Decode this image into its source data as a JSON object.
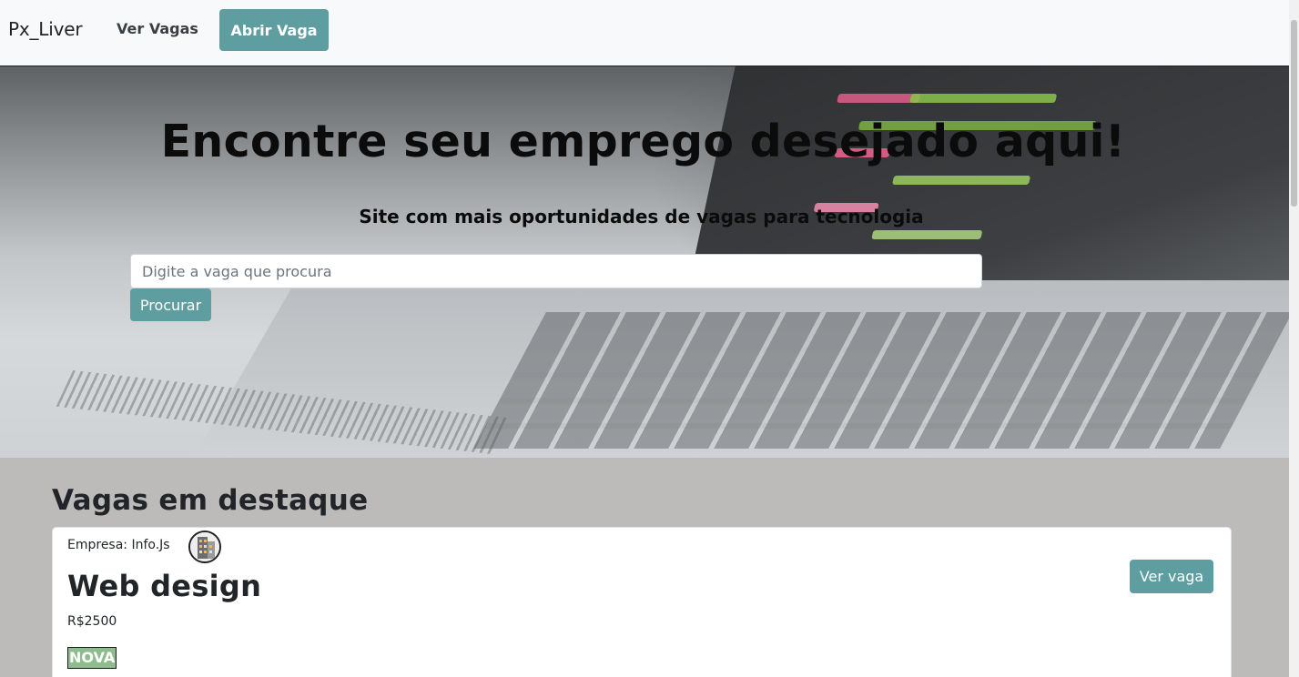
{
  "navbar": {
    "brand": "Px_Liver",
    "link_view_jobs": "Ver Vagas",
    "cta_open_job": "Abrir Vaga"
  },
  "hero": {
    "title": "Encontre seu emprego desejado aqui!",
    "subtitle": "Site com mais oportunidades de vagas para tecnologia",
    "search": {
      "placeholder": "Digite a vaga que procura",
      "value": "",
      "button_label": "Procurar"
    }
  },
  "featured": {
    "title": "Vagas em destaque",
    "jobs": [
      {
        "company": "Empresa: Info.Js",
        "company_icon": "building-icon",
        "title": "Web design",
        "salary": "R$2500",
        "badge": "NOVA",
        "button_label": "Ver vaga"
      }
    ]
  },
  "colors": {
    "accent": "#5f9ea0",
    "badge_new": "#8fbc8f",
    "navbar_bg": "#f8f9fa",
    "page_bg": "#bdbbb9"
  }
}
